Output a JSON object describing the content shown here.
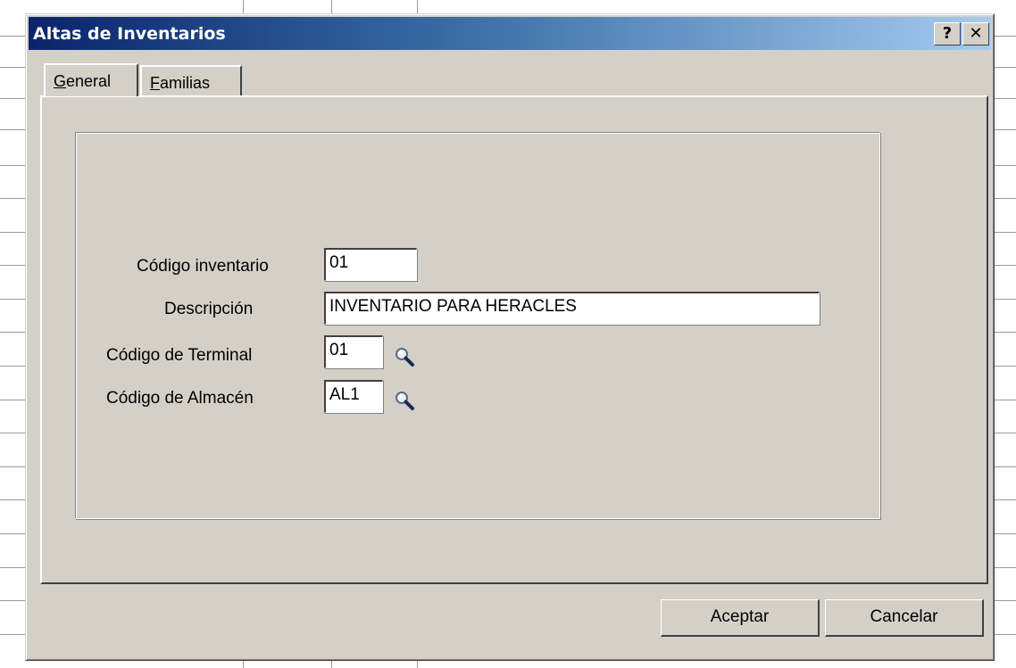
{
  "window": {
    "title": "Altas de  Inventarios",
    "help_button": "?",
    "close_button": "✕"
  },
  "tabs": [
    {
      "label_accel": "G",
      "label_rest": "eneral",
      "selected": true
    },
    {
      "label_accel": "F",
      "label_rest": "amilias",
      "selected": false
    }
  ],
  "form": {
    "codigo_inventario": {
      "label": "Código inventario",
      "value": "01"
    },
    "descripcion": {
      "label": "Descripción",
      "value": "INVENTARIO PARA HERACLES"
    },
    "codigo_terminal": {
      "label": "Código de Terminal",
      "value": "01",
      "lookup_icon": "magnifier-icon"
    },
    "codigo_almacen": {
      "label": "Código de Almacén",
      "value": "AL1",
      "lookup_icon": "magnifier-icon"
    }
  },
  "buttons": {
    "aceptar": "Aceptar",
    "cancelar": "Cancelar"
  }
}
